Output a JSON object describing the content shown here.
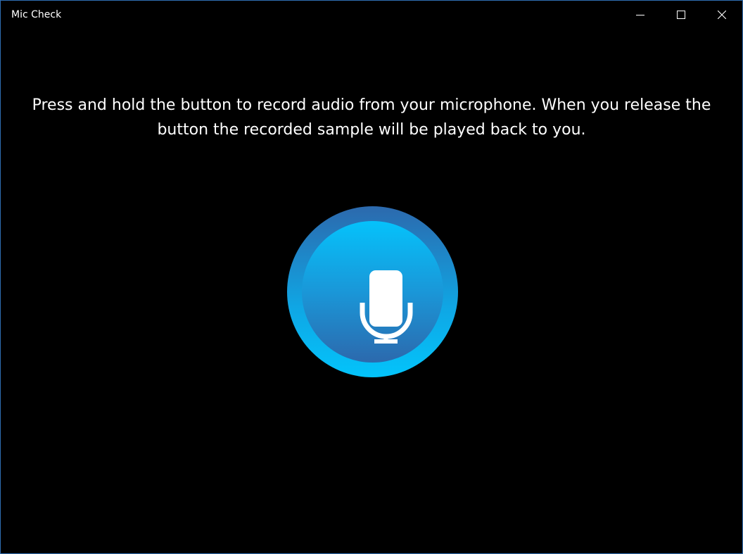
{
  "window": {
    "title": "Mic Check"
  },
  "main": {
    "instructions": "Press and hold the button to record audio from your microphone. When you release the button the recorded sample will be played back to you."
  },
  "icons": {
    "minimize": "minimize-icon",
    "maximize": "maximize-icon",
    "close": "close-icon",
    "record": "microphone-icon"
  },
  "colors": {
    "background": "#000000",
    "window_border": "#2f6fb4",
    "button_outer_top": "#2c69ad",
    "button_outer_bottom": "#03c4fb",
    "button_inner_top": "#05c2fb",
    "button_inner_bottom": "#2c69ad",
    "text": "#ffffff"
  }
}
